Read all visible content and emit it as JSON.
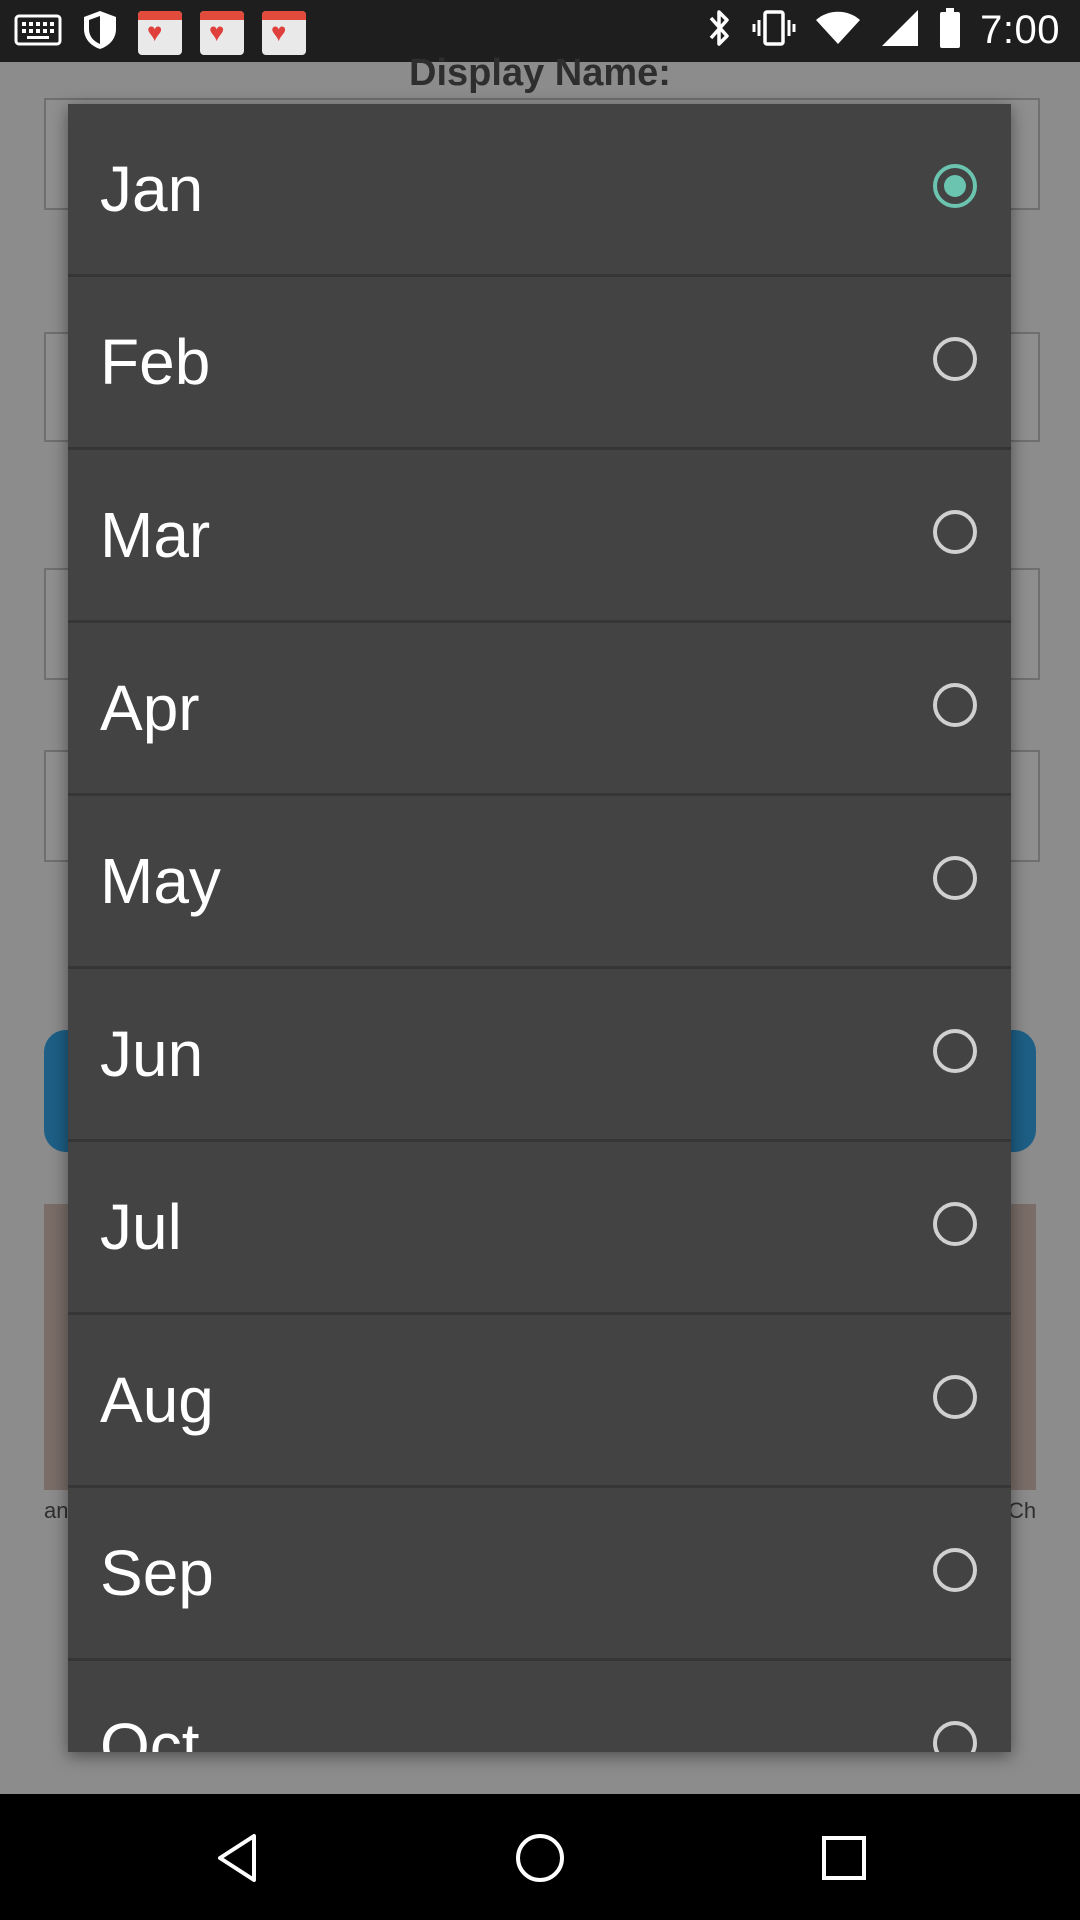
{
  "status_bar": {
    "time": "7:00",
    "notification_icons": [
      "fastmeet-notification-icon",
      "fastmeet-notification-icon",
      "fastmeet-notification-icon"
    ],
    "right_icons": [
      "bluetooth-icon",
      "vibrate-icon",
      "wifi-icon",
      "cell-signal-icon",
      "battery-icon"
    ]
  },
  "background_screen": {
    "title": "Display Name:"
  },
  "month_picker": {
    "selected": "Jan",
    "options": [
      {
        "label": "Jan",
        "checked": true
      },
      {
        "label": "Feb",
        "checked": false
      },
      {
        "label": "Mar",
        "checked": false
      },
      {
        "label": "Apr",
        "checked": false
      },
      {
        "label": "May",
        "checked": false
      },
      {
        "label": "Jun",
        "checked": false
      },
      {
        "label": "Jul",
        "checked": false
      },
      {
        "label": "Aug",
        "checked": false
      },
      {
        "label": "Sep",
        "checked": false
      },
      {
        "label": "Oct",
        "checked": false
      }
    ]
  },
  "navigation_bar": {
    "buttons": [
      "back-icon",
      "home-icon",
      "recents-icon"
    ]
  },
  "colors": {
    "dialog_background": "#434343",
    "radio_selected": "#6bc4b0",
    "radio_unselected": "#d0d0d0",
    "status_bar": "#1e1e1e"
  }
}
